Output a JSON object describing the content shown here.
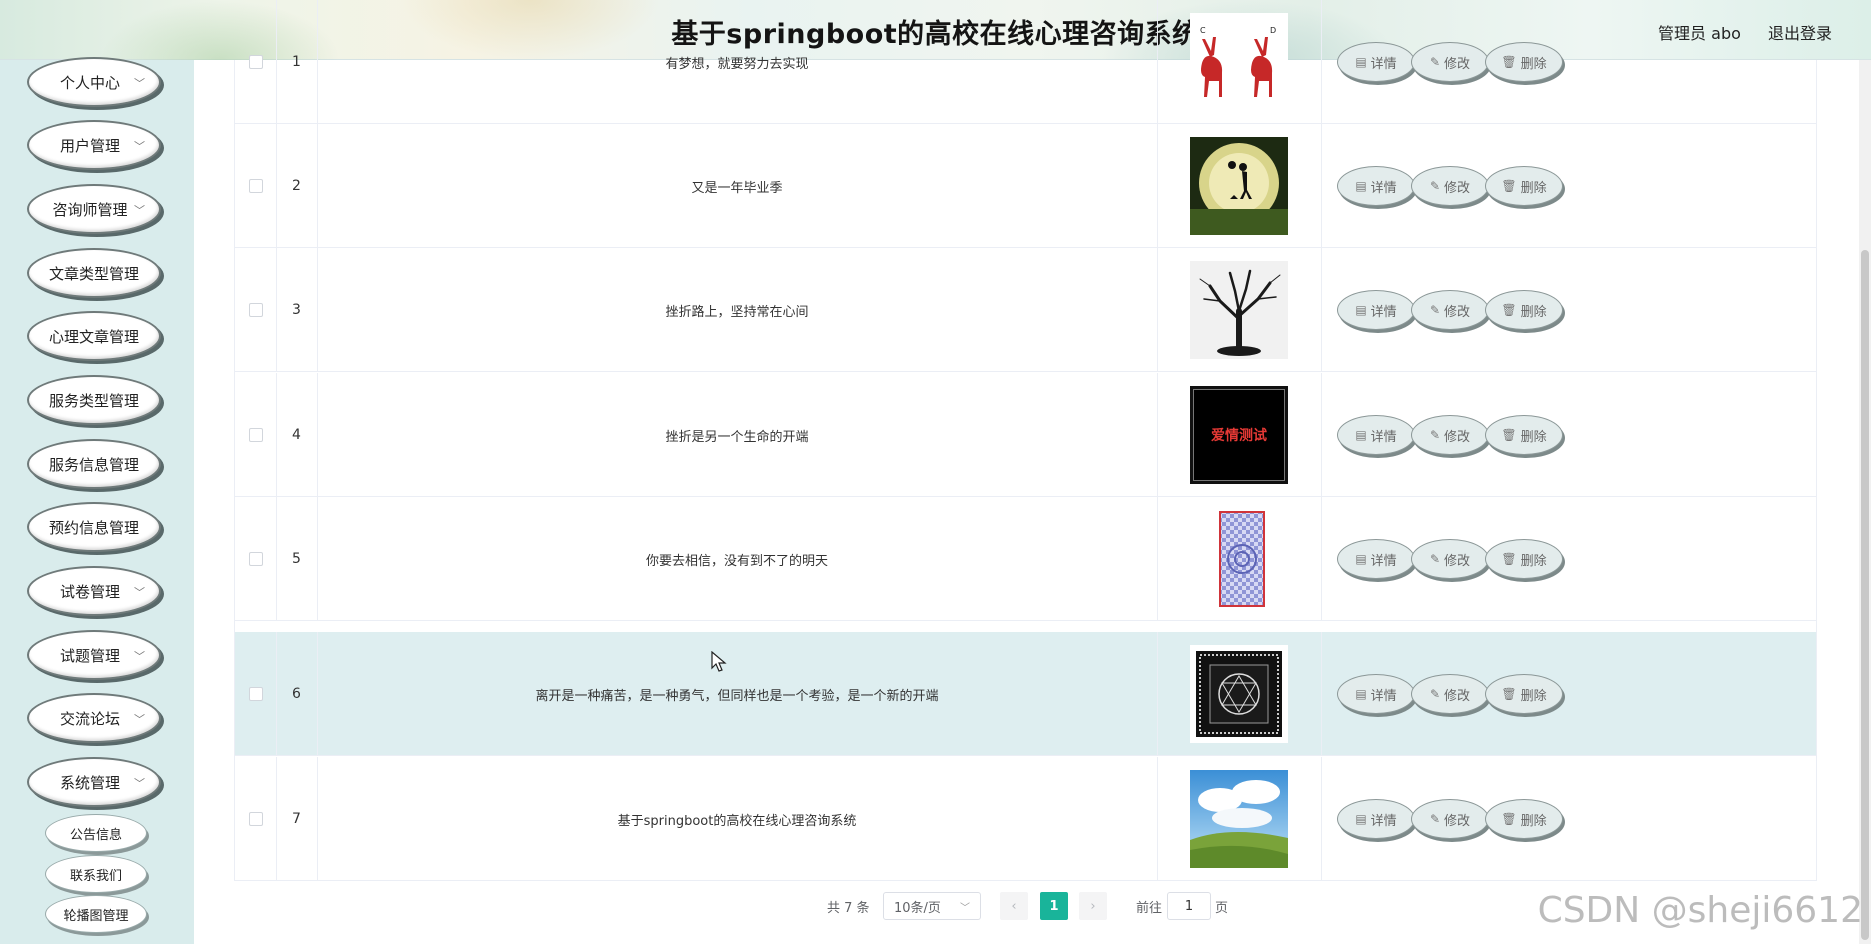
{
  "header": {
    "title": "基于springboot的高校在线心理咨询系统",
    "user_label": "管理员 abo",
    "logout_label": "退出登录"
  },
  "sidebar": {
    "items": [
      {
        "label": "个人中心",
        "expandable": true
      },
      {
        "label": "用户管理",
        "expandable": true
      },
      {
        "label": "咨询师管理",
        "expandable": true
      },
      {
        "label": "文章类型管理",
        "expandable": false
      },
      {
        "label": "心理文章管理",
        "expandable": false
      },
      {
        "label": "服务类型管理",
        "expandable": false
      },
      {
        "label": "服务信息管理",
        "expandable": false
      },
      {
        "label": "预约信息管理",
        "expandable": false
      },
      {
        "label": "试卷管理",
        "expandable": true
      },
      {
        "label": "试题管理",
        "expandable": true
      },
      {
        "label": "交流论坛",
        "expandable": true
      },
      {
        "label": "系统管理",
        "expandable": true
      }
    ],
    "sub_items": [
      {
        "label": "公告信息"
      },
      {
        "label": "联系我们"
      },
      {
        "label": "轮播图管理"
      }
    ]
  },
  "table": {
    "rows": [
      {
        "index": "1",
        "title": "有梦想，就要努力去实现",
        "image": "deer"
      },
      {
        "index": "2",
        "title": "又是一年毕业季",
        "image": "moon"
      },
      {
        "index": "3",
        "title": "挫折路上，坚持常在心间",
        "image": "tree"
      },
      {
        "index": "4",
        "title": "挫折是另一个生命的开端",
        "image": "love-test",
        "image_text": "爱情测试"
      },
      {
        "index": "5",
        "title": "你要去相信，没有到不了的明天",
        "image": "illusion"
      },
      {
        "index": "6",
        "title": "离开是一种痛苦，是一种勇气，但同样也是一个考验，是一个新的开端",
        "image": "carpet"
      },
      {
        "index": "7",
        "title": "基于springboot的高校在线心理咨询系统",
        "image": "meadow"
      }
    ],
    "actions": {
      "detail_label": "详情",
      "edit_label": "修改",
      "delete_label": "删除"
    },
    "highlight_row": 6,
    "highlight_color": "#deeef0"
  },
  "pagination": {
    "total_label": "共 7 条",
    "page_size": "10条/页",
    "current_page": "1",
    "goto_label": "前往",
    "goto_value": "1",
    "page_unit": "页",
    "active_color": "#19b49a"
  },
  "watermark": "CSDN @sheji6612"
}
